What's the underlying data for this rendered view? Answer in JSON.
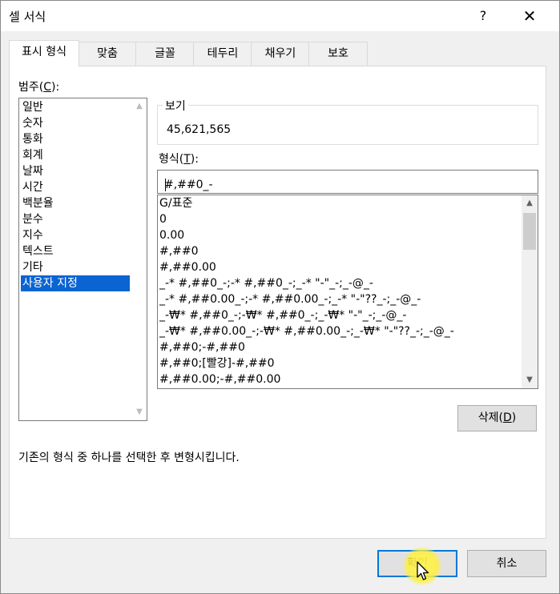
{
  "dialog": {
    "title": "셀 서식",
    "help": "?",
    "close": "✕"
  },
  "tabs": [
    "표시 형식",
    "맞춤",
    "글꼴",
    "테두리",
    "채우기",
    "보호"
  ],
  "category": {
    "label_prefix": "범주(",
    "label_key": "C",
    "label_suffix": "):",
    "items": [
      "일반",
      "숫자",
      "통화",
      "회계",
      "날짜",
      "시간",
      "백분율",
      "분수",
      "지수",
      "텍스트",
      "기타",
      "사용자 지정"
    ],
    "selected": "사용자 지정"
  },
  "preview": {
    "legend": "보기",
    "value": "45,621,565"
  },
  "format": {
    "label_prefix": "형식(",
    "label_key": "T",
    "label_suffix": "):",
    "input_value": "#,##0_-",
    "list": [
      "G/표준",
      "0",
      "0.00",
      "#,##0",
      "#,##0.00",
      "_-* #,##0_-;-* #,##0_-;_-* \"-\"_-;_-@_-",
      "_-* #,##0.00_-;-* #,##0.00_-;_-* \"-\"??_-;_-@_-",
      "_-₩* #,##0_-;-₩* #,##0_-;_-₩* \"-\"_-;_-@_-",
      "_-₩* #,##0.00_-;-₩* #,##0.00_-;_-₩* \"-\"??_-;_-@_-",
      "#,##0;-#,##0",
      "#,##0;[빨강]-#,##0",
      "#,##0.00;-#,##0.00"
    ]
  },
  "delete_button": {
    "prefix": "삭제(",
    "key": "D",
    "suffix": ")"
  },
  "description": "기존의 형식 중 하나를 선택한 후 변형시킵니다.",
  "footer": {
    "ok": "확인",
    "cancel": "취소"
  }
}
